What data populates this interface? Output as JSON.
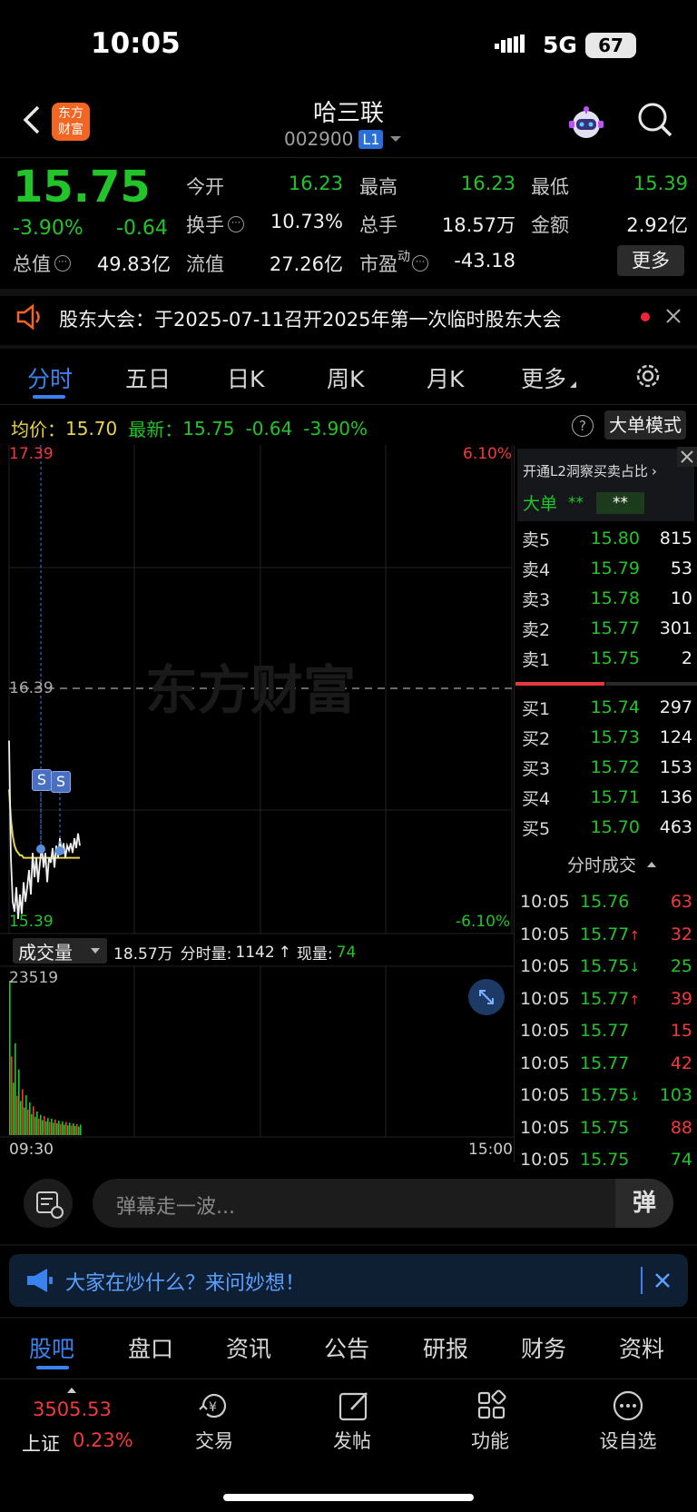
{
  "status_bar": {
    "time": "10:05",
    "network": "5G",
    "battery": "67"
  },
  "header": {
    "title": "哈三联",
    "code": "002900",
    "level_badge": "L1",
    "brand_logo_text": "东方财富"
  },
  "quote": {
    "price": "15.75",
    "change_pct": "-3.90%",
    "change": "-0.64",
    "open_label": "今开",
    "open": "16.23",
    "high_label": "最高",
    "high": "16.23",
    "low_label": "最低",
    "low": "15.39",
    "turnover_label": "换手",
    "turnover": "10.73%",
    "volume_label": "总手",
    "volume": "18.57万",
    "amount_label": "金额",
    "amount": "2.92亿",
    "mktcap_label": "总值",
    "mktcap": "49.83亿",
    "float_label": "流值",
    "float_cap": "27.26亿",
    "pe_label": "市盈",
    "pe_sup": "动",
    "pe": "-43.18",
    "more_button": "更多"
  },
  "notice": {
    "text": "股东大会：于2025-07-11召开2025年第一次临时股东大会"
  },
  "tabs": [
    "分时",
    "五日",
    "日K",
    "周K",
    "月K",
    "更多"
  ],
  "active_tab": "分时",
  "info_line": {
    "avg_label": "均价：",
    "avg": "15.70",
    "latest_label": "最新：",
    "latest": "15.75",
    "chg": "-0.64",
    "pct": "-3.90%",
    "mode_button": "大单模式"
  },
  "chart": {
    "y_top": "17.39",
    "y_mid": "16.39",
    "y_bottom": "15.39",
    "pct_top": "6.10%",
    "pct_bottom": "-6.10%",
    "watermark": "东方财富",
    "marker_label": "S",
    "volume_selector": "成交量",
    "volume_total": "18.57万",
    "minute_vol_label": "分时量:",
    "minute_vol": "1142",
    "now_vol_label": "现量:",
    "now_vol": "74",
    "vol_max": "23519",
    "x_start": "09:30",
    "x_end": "15:00"
  },
  "order_book": {
    "promo": "开通L2洞察买卖占比",
    "big_order_label": "大单",
    "big_order_value": "**",
    "big_order_value2": "**",
    "asks": [
      {
        "label": "卖5",
        "price": "15.80",
        "vol": "815"
      },
      {
        "label": "卖4",
        "price": "15.79",
        "vol": "53"
      },
      {
        "label": "卖3",
        "price": "15.78",
        "vol": "10"
      },
      {
        "label": "卖2",
        "price": "15.77",
        "vol": "301"
      },
      {
        "label": "卖1",
        "price": "15.75",
        "vol": "2"
      }
    ],
    "bids": [
      {
        "label": "买1",
        "price": "15.74",
        "vol": "297"
      },
      {
        "label": "买2",
        "price": "15.73",
        "vol": "124"
      },
      {
        "label": "买3",
        "price": "15.72",
        "vol": "153"
      },
      {
        "label": "买4",
        "price": "15.71",
        "vol": "136"
      },
      {
        "label": "买5",
        "price": "15.70",
        "vol": "463"
      }
    ]
  },
  "trades": {
    "title": "分时成交",
    "rows": [
      {
        "time": "10:05",
        "price": "15.76",
        "vol": "63",
        "arrow": "",
        "color": "#f23a3a"
      },
      {
        "time": "10:05",
        "price": "15.77",
        "vol": "32",
        "arrow": "↑",
        "color": "#f23a3a"
      },
      {
        "time": "10:05",
        "price": "15.75",
        "vol": "25",
        "arrow": "↓",
        "color": "#22c42a"
      },
      {
        "time": "10:05",
        "price": "15.77",
        "vol": "39",
        "arrow": "↑",
        "color": "#f23a3a"
      },
      {
        "time": "10:05",
        "price": "15.77",
        "vol": "15",
        "arrow": "",
        "color": "#f23a3a"
      },
      {
        "time": "10:05",
        "price": "15.77",
        "vol": "42",
        "arrow": "",
        "color": "#f23a3a"
      },
      {
        "time": "10:05",
        "price": "15.75",
        "vol": "103",
        "arrow": "↓",
        "color": "#22c42a"
      },
      {
        "time": "10:05",
        "price": "15.75",
        "vol": "88",
        "arrow": "",
        "color": "#f23a3a"
      },
      {
        "time": "10:05",
        "price": "15.75",
        "vol": "74",
        "arrow": "",
        "color": "#22c42a"
      }
    ]
  },
  "comment_bar": {
    "placeholder": "弹幕走一波...",
    "danmu_button": "弹"
  },
  "ask_banner": {
    "text": "大家在炒什么？来问妙想！"
  },
  "bottom_tabs": [
    "股吧",
    "盘口",
    "资讯",
    "公告",
    "研报",
    "财务",
    "资料"
  ],
  "active_bottom_tab": "股吧",
  "index": {
    "value": "3505.53",
    "name": "上证",
    "pct": "0.23%"
  },
  "nav": {
    "trade": "交易",
    "post": "发帖",
    "func": "功能",
    "watch": "设自选"
  }
}
